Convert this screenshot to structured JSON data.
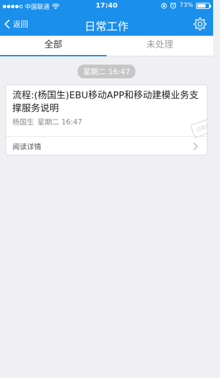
{
  "status_bar": {
    "carrier": "中国联通",
    "time": "17:40",
    "battery_text": "73%",
    "battery_level": 0.73
  },
  "nav": {
    "back_label": "返回",
    "title": "日常工作"
  },
  "tabs": [
    {
      "label": "全部",
      "active": true
    },
    {
      "label": "未处理",
      "active": false
    }
  ],
  "date_pill": "星期二 16:47",
  "card": {
    "title": "流程:(杨国生)EBU移动APP和移动建模业务支撑服务说明",
    "author": "杨国生",
    "date": "星期二 16:47",
    "stamp_text": "已处理",
    "read_more_label": "阅读详情"
  },
  "colors": {
    "header": "#1a8fec",
    "background": "#efeff4"
  }
}
